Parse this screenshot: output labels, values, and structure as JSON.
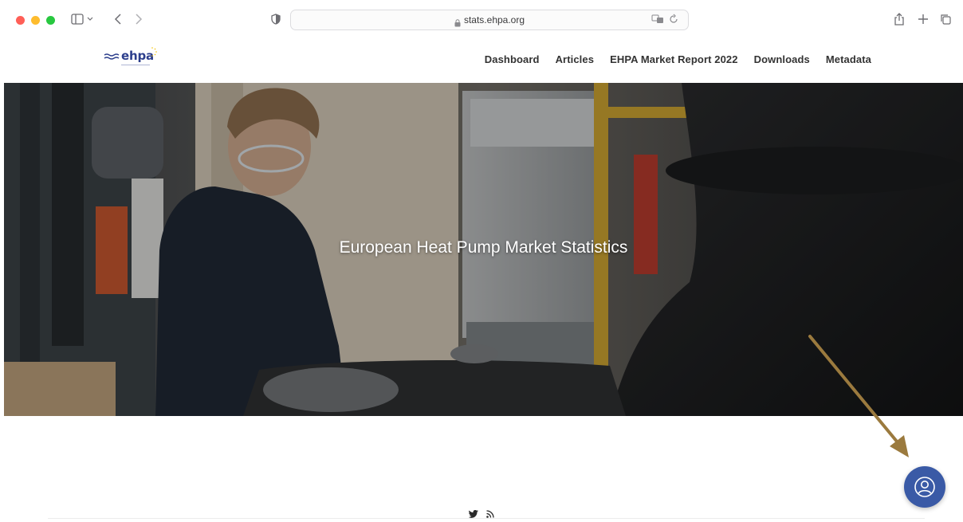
{
  "browser": {
    "url": "stats.ehpa.org"
  },
  "site": {
    "logo_text": "ehpa",
    "nav": [
      {
        "label": "Dashboard"
      },
      {
        "label": "Articles"
      },
      {
        "label": "EHPA Market Report 2022"
      },
      {
        "label": "Downloads"
      },
      {
        "label": "Metadata"
      }
    ]
  },
  "hero": {
    "title": "European Heat Pump Market Statistics"
  },
  "icons": {
    "chat": "user-support-icon",
    "twitter": "twitter-icon",
    "rss": "rss-icon"
  },
  "colors": {
    "brand": "#2c3e8c",
    "chat_button": "#3a5aa6",
    "annotation_arrow": "#9b7a3e"
  }
}
